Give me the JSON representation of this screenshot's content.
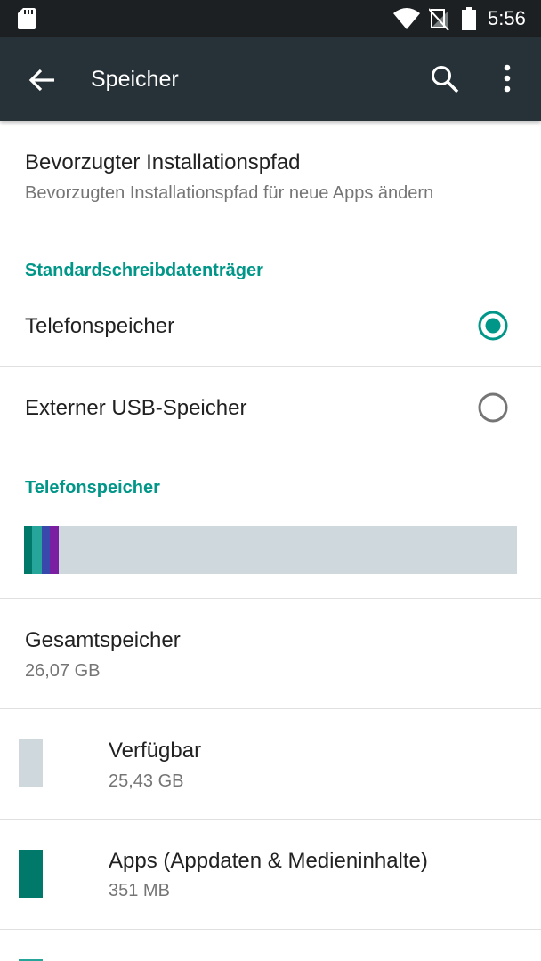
{
  "status_bar": {
    "time": "5:56",
    "icons": [
      "sd-card-icon",
      "wifi-icon",
      "no-signal-icon",
      "battery-icon"
    ]
  },
  "toolbar": {
    "title": "Speicher",
    "back_icon": "arrow-back-icon",
    "search_icon": "search-icon",
    "more_icon": "more-vert-icon"
  },
  "install_path": {
    "title": "Bevorzugter Installationspfad",
    "summary": "Bevorzugten Installationspfad für neue Apps ändern"
  },
  "default_write_disk": {
    "header": "Standardschreibdatenträger",
    "options": [
      {
        "label": "Telefonspeicher",
        "selected": true
      },
      {
        "label": "Externer USB-Speicher",
        "selected": false
      }
    ]
  },
  "phone_storage": {
    "header": "Telefonspeicher",
    "usage_bar": {
      "segments": [
        {
          "color": "#00796b",
          "fraction": 0.016
        },
        {
          "color": "#26a69a",
          "fraction": 0.02
        },
        {
          "color": "#3949ab",
          "fraction": 0.016
        },
        {
          "color": "#7b1fa2",
          "fraction": 0.019
        }
      ],
      "free_color": "#cfd8dc"
    },
    "total": {
      "title": "Gesamtspeicher",
      "value": "26,07 GB"
    },
    "items": [
      {
        "title": "Verfügbar",
        "value": "25,43 GB",
        "color": "#cfd8dc"
      },
      {
        "title": "Apps (Appdaten & Medieninhalte)",
        "value": "351 MB",
        "color": "#00796b"
      }
    ],
    "next_item_color": "#26a69a"
  },
  "colors": {
    "accent": "#009688",
    "toolbar": "#263238",
    "status_bar": "#1d2022"
  }
}
